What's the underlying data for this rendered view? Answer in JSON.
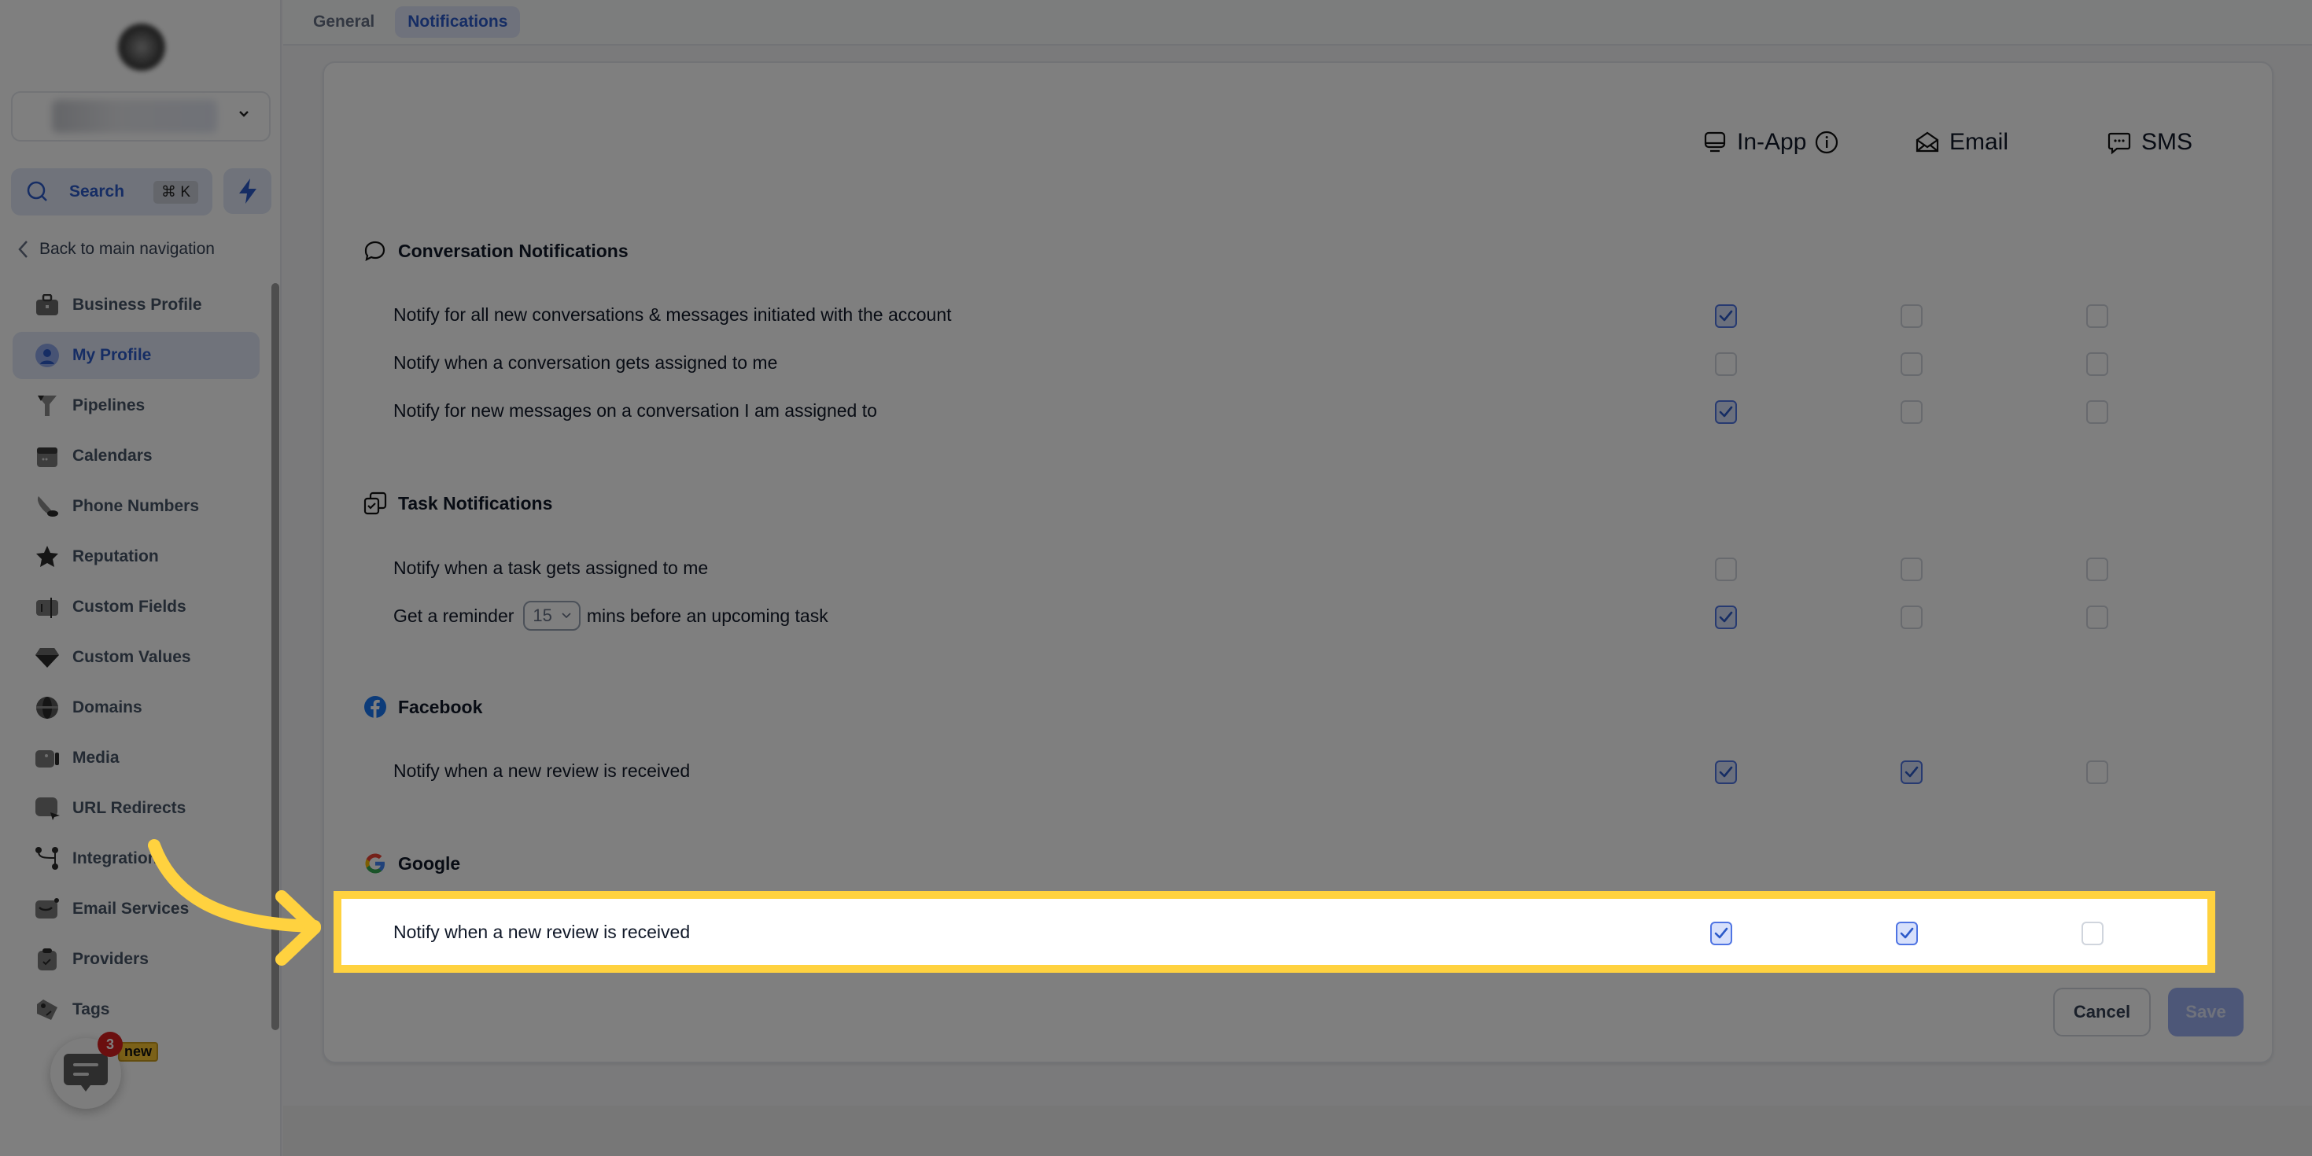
{
  "sidebar": {
    "search": {
      "label": "Search",
      "shortcut": "⌘ K"
    },
    "back_link": "Back to main navigation",
    "items": [
      {
        "label": "Business Profile",
        "icon": "briefcase-icon",
        "active": false
      },
      {
        "label": "My Profile",
        "icon": "user-circle-icon",
        "active": true
      },
      {
        "label": "Pipelines",
        "icon": "funnel-icon",
        "active": false
      },
      {
        "label": "Calendars",
        "icon": "calendar-icon",
        "active": false
      },
      {
        "label": "Phone Numbers",
        "icon": "phone-icon",
        "active": false
      },
      {
        "label": "Reputation",
        "icon": "star-icon",
        "active": false
      },
      {
        "label": "Custom Fields",
        "icon": "text-field-icon",
        "active": false
      },
      {
        "label": "Custom Values",
        "icon": "diamond-icon",
        "active": false
      },
      {
        "label": "Domains",
        "icon": "globe-icon",
        "active": false
      },
      {
        "label": "Media",
        "icon": "video-icon",
        "active": false
      },
      {
        "label": "URL Redirects",
        "icon": "cursor-click-icon",
        "active": false
      },
      {
        "label": "Integrations",
        "icon": "git-branch-icon",
        "active": false
      },
      {
        "label": "Email Services",
        "icon": "mail-icon",
        "active": false
      },
      {
        "label": "Providers",
        "icon": "clipboard-check-icon",
        "active": false
      },
      {
        "label": "Tags",
        "icon": "tag-icon",
        "active": false
      }
    ],
    "new_badge": "new",
    "chat_unread_count": "3"
  },
  "tabs": [
    {
      "label": "General",
      "active": false
    },
    {
      "label": "Notifications",
      "active": true
    }
  ],
  "channels": [
    {
      "label": "In-App",
      "icon": "monitor-icon",
      "info": true
    },
    {
      "label": "Email",
      "icon": "envelope-open-icon",
      "info": false
    },
    {
      "label": "SMS",
      "icon": "chat-dots-icon",
      "info": false
    }
  ],
  "sections": [
    {
      "title": "Conversation Notifications",
      "icon": "chat-bubble-icon",
      "rows": [
        {
          "label": "Notify for all new conversations & messages initiated with the account",
          "in_app": true,
          "email": false,
          "sms": false
        },
        {
          "label": "Notify when a conversation gets assigned to me",
          "in_app": false,
          "email": false,
          "sms": false
        },
        {
          "label": "Notify for new messages on a conversation I am assigned to",
          "in_app": true,
          "email": false,
          "sms": false
        }
      ]
    },
    {
      "title": "Task Notifications",
      "icon": "tasks-icon",
      "rows": [
        {
          "label": "Notify when a task gets assigned to me",
          "in_app": false,
          "email": false,
          "sms": false
        },
        {
          "label_before": "Get a reminder",
          "select_value": "15",
          "label_after": "mins before an upcoming task",
          "in_app": true,
          "email": false,
          "sms": false
        }
      ]
    },
    {
      "title": "Facebook",
      "icon": "facebook-icon",
      "rows": [
        {
          "label": "Notify when a new review is received",
          "in_app": true,
          "email": true,
          "sms": false
        }
      ]
    },
    {
      "title": "Google",
      "icon": "google-icon",
      "rows": [
        {
          "label": "Notify when a new review is received",
          "in_app": true,
          "email": true,
          "sms": false
        }
      ]
    }
  ],
  "actions": {
    "cancel": "Cancel",
    "save": "Save"
  },
  "colors": {
    "accent": "#2c5ac9",
    "highlight": "#ffd23f",
    "checkbox_checked_bg": "#d7e0fb"
  }
}
